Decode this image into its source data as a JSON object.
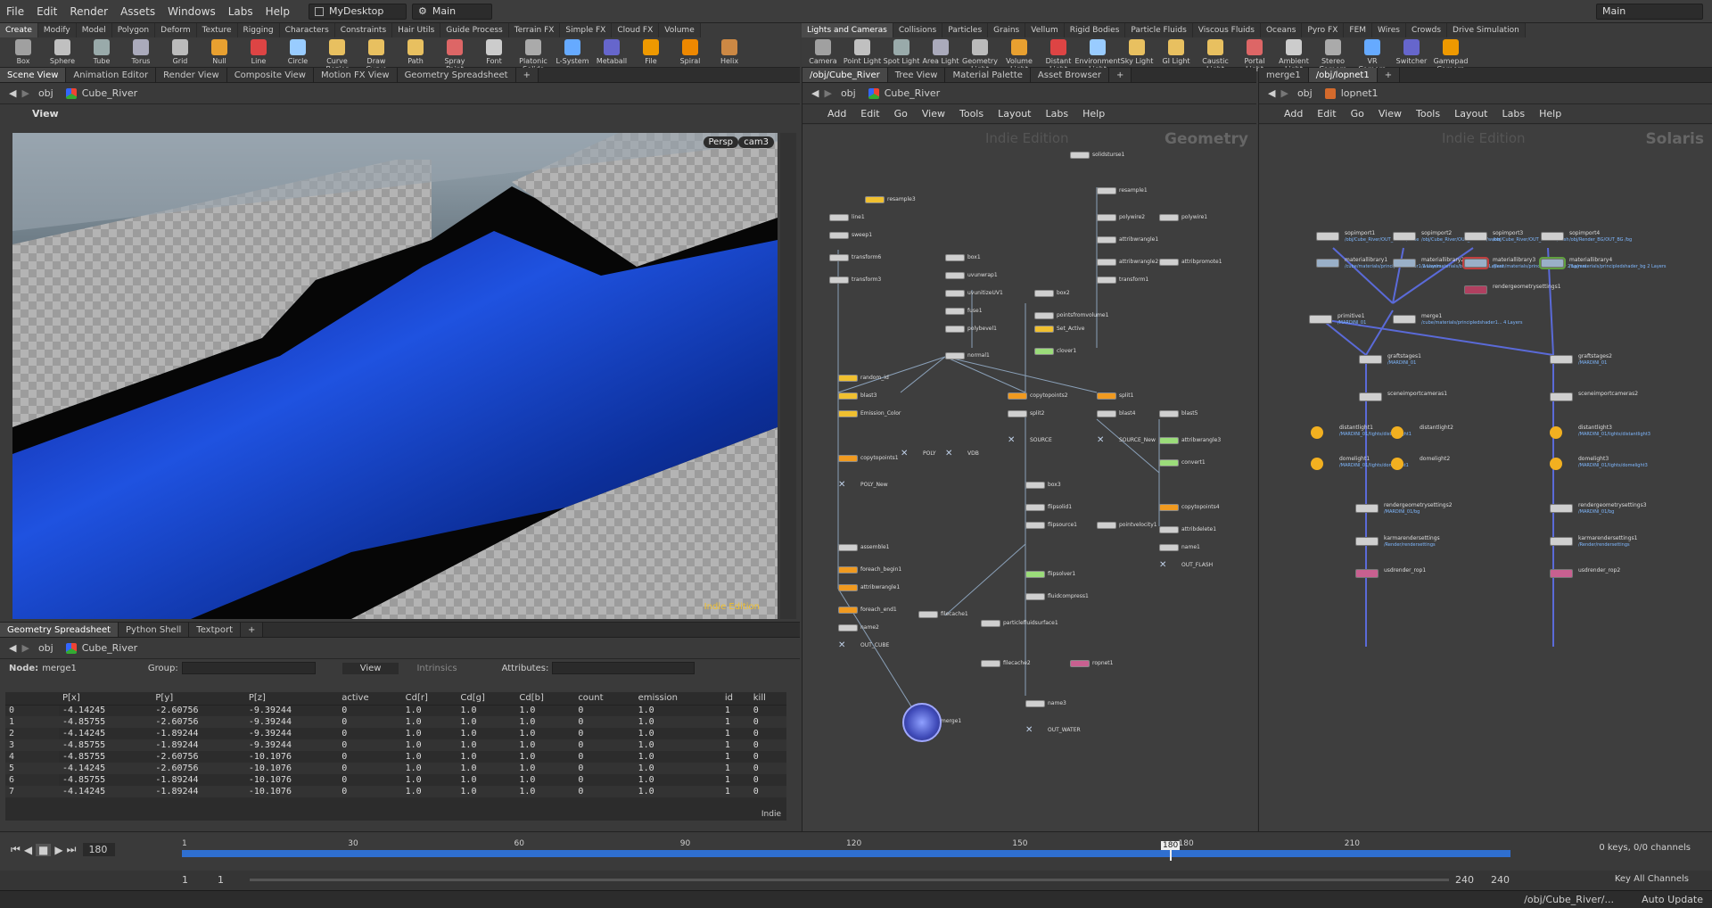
{
  "menu": [
    "File",
    "Edit",
    "Render",
    "Assets",
    "Windows",
    "Labs",
    "Help"
  ],
  "desktop": "MyDesktop",
  "session": "Main",
  "top_right_label": "Main",
  "shelf_left": {
    "tabs": [
      "Create",
      "Modify",
      "Model",
      "Polygon",
      "Deform",
      "Texture",
      "Rigging",
      "Characters",
      "Constraints",
      "Hair Utils",
      "Guide Process",
      "Terrain FX",
      "Simple FX",
      "Cloud FX",
      "Volume"
    ],
    "tools": [
      "Box",
      "Sphere",
      "Tube",
      "Torus",
      "Grid",
      "Null",
      "Line",
      "Circle",
      "Curve Bezier",
      "Draw Curve",
      "Path",
      "Spray Paint",
      "Font",
      "Platonic Solids",
      "L-System",
      "Metaball",
      "File",
      "Spiral",
      "Helix"
    ]
  },
  "shelf_right": {
    "tabs": [
      "Lights and Cameras",
      "Collisions",
      "Particles",
      "Grains",
      "Vellum",
      "Rigid Bodies",
      "Particle Fluids",
      "Viscous Fluids",
      "Oceans",
      "Pyro FX",
      "FEM",
      "Wires",
      "Crowds",
      "Drive Simulation"
    ],
    "tools": [
      "Camera",
      "Point Light",
      "Spot Light",
      "Area Light",
      "Geometry Light",
      "Volume Light",
      "Distant Light",
      "Environment Light",
      "Sky Light",
      "GI Light",
      "Caustic Light",
      "Portal Light",
      "Ambient Light",
      "Stereo Camera",
      "VR Camera",
      "Switcher",
      "Gamepad Camera"
    ]
  },
  "viewport_pane": {
    "tabs": [
      "Scene View",
      "Animation Editor",
      "Render View",
      "Composite View",
      "Motion FX View",
      "Geometry Spreadsheet"
    ],
    "path_root": "obj",
    "path_node": "Cube_River",
    "view_label": "View",
    "persp": "Persp",
    "camera": "cam3",
    "watermark": "Indie Edition"
  },
  "spreadsheet_pane": {
    "tabs": [
      "Geometry Spreadsheet",
      "Python Shell",
      "Textport"
    ],
    "path_root": "obj",
    "path_node": "Cube_River",
    "node_label": "Node:",
    "node_value": "merge1",
    "group_label": "Group:",
    "view_button": "View",
    "intrinsics": "Intrinsics",
    "attributes_label": "Attributes:",
    "corner_label": "Indie",
    "columns": [
      "",
      "P[x]",
      "P[y]",
      "P[z]",
      "active",
      "Cd[r]",
      "Cd[g]",
      "Cd[b]",
      "count",
      "emission",
      "id",
      "kill"
    ],
    "rows": [
      [
        "0",
        "-4.14245",
        "-2.60756",
        "-9.39244",
        "0",
        "1.0",
        "1.0",
        "1.0",
        "0",
        "1.0",
        "1",
        "0"
      ],
      [
        "1",
        "-4.85755",
        "-2.60756",
        "-9.39244",
        "0",
        "1.0",
        "1.0",
        "1.0",
        "0",
        "1.0",
        "1",
        "0"
      ],
      [
        "2",
        "-4.14245",
        "-1.89244",
        "-9.39244",
        "0",
        "1.0",
        "1.0",
        "1.0",
        "0",
        "1.0",
        "1",
        "0"
      ],
      [
        "3",
        "-4.85755",
        "-1.89244",
        "-9.39244",
        "0",
        "1.0",
        "1.0",
        "1.0",
        "0",
        "1.0",
        "1",
        "0"
      ],
      [
        "4",
        "-4.85755",
        "-2.60756",
        "-10.1076",
        "0",
        "1.0",
        "1.0",
        "1.0",
        "0",
        "1.0",
        "1",
        "0"
      ],
      [
        "5",
        "-4.14245",
        "-2.60756",
        "-10.1076",
        "0",
        "1.0",
        "1.0",
        "1.0",
        "0",
        "1.0",
        "1",
        "0"
      ],
      [
        "6",
        "-4.85755",
        "-1.89244",
        "-10.1076",
        "0",
        "1.0",
        "1.0",
        "1.0",
        "0",
        "1.0",
        "1",
        "0"
      ],
      [
        "7",
        "-4.14245",
        "-1.89244",
        "-10.1076",
        "0",
        "1.0",
        "1.0",
        "1.0",
        "0",
        "1.0",
        "1",
        "0"
      ]
    ]
  },
  "network_center": {
    "tabs": [
      "/obj/Cube_River",
      "Tree View",
      "Material Palette",
      "Asset Browser"
    ],
    "path_root": "obj",
    "path_node": "Cube_River",
    "menu": [
      "Add",
      "Edit",
      "Go",
      "View",
      "Tools",
      "Layout",
      "Labs",
      "Help"
    ],
    "watermark": "Indie Edition",
    "context": "Geometry",
    "nodes": [
      "solidsturse1",
      "resample3",
      "line1",
      "sweep1",
      "transform6",
      "transform3",
      "box1",
      "uvunwrap1",
      "uvunitizeUV1",
      "fuse1",
      "polybevel1",
      "normal1",
      "box2",
      "pointsfromvolume1",
      "Set_Active",
      "clover1",
      "random_id",
      "blast3",
      "Emission_Color",
      "copytopoints1",
      "copytopoints2",
      "split1",
      "split2",
      "blast4",
      "blast5",
      "SOURCE",
      "SOURCE_New",
      "POLY",
      "VDB",
      "POLY_New",
      "attribwrangle3",
      "convert1",
      "box3",
      "flipsolid1",
      "flipsource1",
      "pointvelocity1",
      "copytopoints4",
      "attribdelete1",
      "name1",
      "OUT_FLASH",
      "assemble1",
      "foreach_begin1",
      "attribwrangle1",
      "foreach_end1",
      "name2",
      "OUT_CUBE",
      "flipsolver1",
      "fluidcompress1",
      "filecache1",
      "particlefluidsurface1",
      "filecache2",
      "ropnet1",
      "name3",
      "OUT_WATER",
      "merge1",
      "resample1",
      "polywire1",
      "polywire2",
      "attribwrangle1",
      "attribwrangle2",
      "attribpromote1",
      "transform1"
    ]
  },
  "network_right": {
    "tabs": [
      "merge1",
      "/obj/lopnet1"
    ],
    "path_root": "obj",
    "path_node": "lopnet1",
    "menu": [
      "Add",
      "Edit",
      "Go",
      "View",
      "Tools",
      "Layout",
      "Labs",
      "Help"
    ],
    "watermark": "Indie Edition",
    "context": "Solaris",
    "nodes": [
      {
        "name": "sopimport1",
        "sub": "/obj/Cube_River/OUT_CUBE /cube"
      },
      {
        "name": "sopimport2",
        "sub": "/obj/Cube_River/OUT_WATER /water"
      },
      {
        "name": "sopimport3",
        "sub": "/obj/Cube_River/OUT_FLASH /flash"
      },
      {
        "name": "sopimport4",
        "sub": "/obj/Render_BG/OUT_BG /bg"
      },
      {
        "name": "materiallibrary1",
        "sub": "/cube/materials/principledshader1 2 Layers"
      },
      {
        "name": "materiallibrary2",
        "sub": "/water/materials/basicliquid 2 Layers"
      },
      {
        "name": "materiallibrary3",
        "sub": "/flash/materials/principledshader 2 Layers"
      },
      {
        "name": "materiallibrary4",
        "sub": "/bg/materials/principledshader_bg 2 Layers"
      },
      {
        "name": "rendergeometrysettings1",
        "sub": ""
      },
      {
        "name": "primitive1",
        "sub": "/MARDINI_01"
      },
      {
        "name": "merge1",
        "sub": "/cube/materials/principledshader1... 4 Layers"
      },
      {
        "name": "graftstages1",
        "sub": "/MARDINI_01"
      },
      {
        "name": "graftstages2",
        "sub": "/MARDINI_01"
      },
      {
        "name": "sceneimportcameras1",
        "sub": ""
      },
      {
        "name": "sceneimportcameras2",
        "sub": ""
      },
      {
        "name": "distantlight1",
        "sub": "/MARDINI_01/lights/distantlight1"
      },
      {
        "name": "distantlight2",
        "sub": ""
      },
      {
        "name": "distantlight3",
        "sub": "/MARDINI_01/lights/distantlight3"
      },
      {
        "name": "domelight1",
        "sub": "/MARDINI_01/lights/domelight1"
      },
      {
        "name": "domelight2",
        "sub": ""
      },
      {
        "name": "domelight3",
        "sub": "/MARDINI_01/lights/domelight3"
      },
      {
        "name": "rendergeometrysettings2",
        "sub": "/MARDINI_01/bg"
      },
      {
        "name": "rendergeometrysettings3",
        "sub": "/MARDINI_01/bg"
      },
      {
        "name": "karmarendersettings",
        "sub": "/Render/rendersettings"
      },
      {
        "name": "karmarendersettings1",
        "sub": "/Render/rendersettings"
      },
      {
        "name": "usdrender_rop1",
        "sub": ""
      },
      {
        "name": "usdrender_rop2",
        "sub": ""
      }
    ]
  },
  "timeline": {
    "current_frame": "180",
    "ticks": [
      "1",
      "30",
      "60",
      "90",
      "120",
      "150",
      "180",
      "210"
    ],
    "range_start": "1",
    "range_start2": "1",
    "range_end": "240",
    "range_end2": "240",
    "keys": "0 keys, 0/0 channels",
    "key_all": "Key All Channels"
  },
  "status": {
    "path": "/obj/Cube_River/...",
    "auto_update": "Auto Update"
  },
  "colors": {
    "accent_blue": "#2f6fd0",
    "node_yellow": "#f0c030",
    "water_blue": "#1b4fd6"
  }
}
